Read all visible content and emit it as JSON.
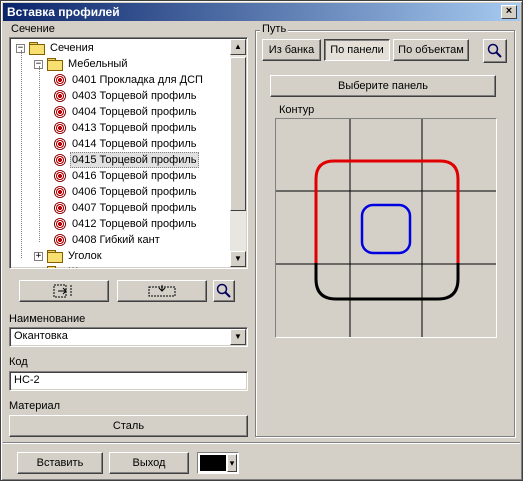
{
  "window": {
    "title": "Вставка профилей",
    "close_glyph": "×"
  },
  "section": {
    "label": "Сечение",
    "tree": [
      {
        "label": "Сечения",
        "kind": "folder",
        "level": 0,
        "expander": "−"
      },
      {
        "label": "Мебельный",
        "kind": "folder",
        "level": 1,
        "expander": "−"
      },
      {
        "label": "0401 Прокладка для ДСП",
        "kind": "profile",
        "level": 2
      },
      {
        "label": "0403 Торцевой профиль",
        "kind": "profile",
        "level": 2
      },
      {
        "label": "0404 Торцевой профиль",
        "kind": "profile",
        "level": 2
      },
      {
        "label": "0413 Торцевой профиль",
        "kind": "profile",
        "level": 2
      },
      {
        "label": "0414 Торцевой профиль",
        "kind": "profile",
        "level": 2
      },
      {
        "label": "0415 Торцевой профиль",
        "kind": "profile",
        "level": 2,
        "selected": true
      },
      {
        "label": "0416 Торцевой профиль",
        "kind": "profile",
        "level": 2
      },
      {
        "label": "0406 Торцевой профиль",
        "kind": "profile",
        "level": 2
      },
      {
        "label": "0407 Торцевой профиль",
        "kind": "profile",
        "level": 2
      },
      {
        "label": "0412 Торцевой профиль",
        "kind": "profile",
        "level": 2
      },
      {
        "label": "0408 Гибкий кант",
        "kind": "profile",
        "level": 2
      },
      {
        "label": "Уголок",
        "kind": "folder",
        "level": 1,
        "expander": "+"
      },
      {
        "label": "Ш...",
        "kind": "folder",
        "level": 1,
        "expander": "+"
      }
    ],
    "tool_icons": [
      "insert-frame-icon",
      "insert-edge-icon",
      "magnifier-icon"
    ]
  },
  "name_field": {
    "label": "Наименование",
    "value": "Окантовка"
  },
  "code_field": {
    "label": "Код",
    "value": "НС-2"
  },
  "material": {
    "label": "Материал",
    "button": "Сталь"
  },
  "path": {
    "title": "Путь",
    "tabs": [
      {
        "label": "Из банка",
        "pressed": false
      },
      {
        "label": "По панели",
        "pressed": true
      },
      {
        "label": "По объектам",
        "pressed": false
      }
    ],
    "select_panel_button": "Выберите панель",
    "contour_label": "Контур",
    "contour_colors": {
      "outer_top": "#e00000",
      "outer_bottom": "#000000",
      "inner": "#0000e0",
      "grid": "#000000"
    }
  },
  "footer": {
    "insert_button": "Вставить",
    "exit_button": "Выход",
    "color_swatch": "#000000",
    "color_arrow": "▾"
  }
}
